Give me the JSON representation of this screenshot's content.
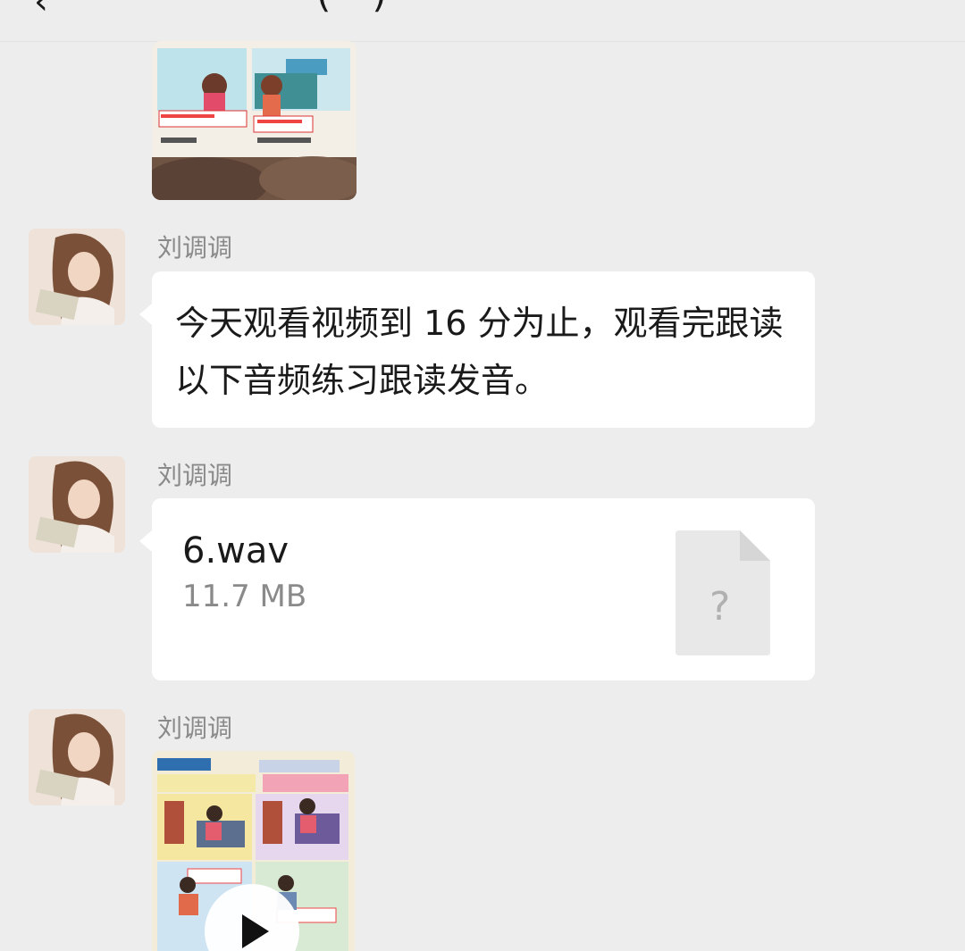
{
  "header": {
    "back_glyph": "‹",
    "title_partial": "　　　　　　(　)"
  },
  "messages": [
    {
      "type": "image",
      "description_icon": "textbook-photo"
    },
    {
      "type": "text",
      "sender": "刘调调",
      "text": "今天观看视频到 16 分为止，观看完跟读以下音频练习跟读发音。"
    },
    {
      "type": "file",
      "sender": "刘调调",
      "file_name": "6.wav",
      "file_size": "11.7 MB",
      "file_icon_glyph": "?"
    },
    {
      "type": "video",
      "sender": "刘调调",
      "description_icon": "textbook-video-thumbnail"
    }
  ],
  "colors": {
    "background": "#ededed",
    "bubble": "#ffffff",
    "sender_text": "#8a8a8a",
    "file_icon_bg": "#e8e8e8"
  }
}
